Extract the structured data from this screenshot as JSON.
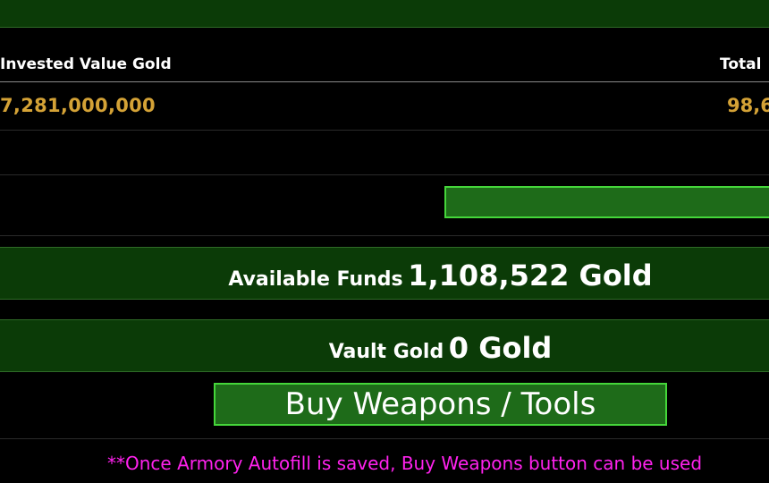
{
  "stats": {
    "invested_label": "Invested Value Gold",
    "total_label": "Total",
    "invested_value": "7,281,000,000",
    "total_value": "98,6"
  },
  "funds": {
    "label": "Available Funds",
    "value": "1,108,522 Gold"
  },
  "vault": {
    "label": "Vault Gold",
    "value": "0 Gold"
  },
  "actions": {
    "buy_label": "Buy Weapons / Tools"
  },
  "notes": {
    "autofill_note": "**Once Armory Autofill is saved, Buy Weapons button can be used"
  },
  "colors": {
    "bar_green": "#0b3b07",
    "button_green": "#1e6b19",
    "button_border": "#45d63a",
    "gold_text": "#d4a236",
    "note_magenta": "#ff22ee"
  }
}
